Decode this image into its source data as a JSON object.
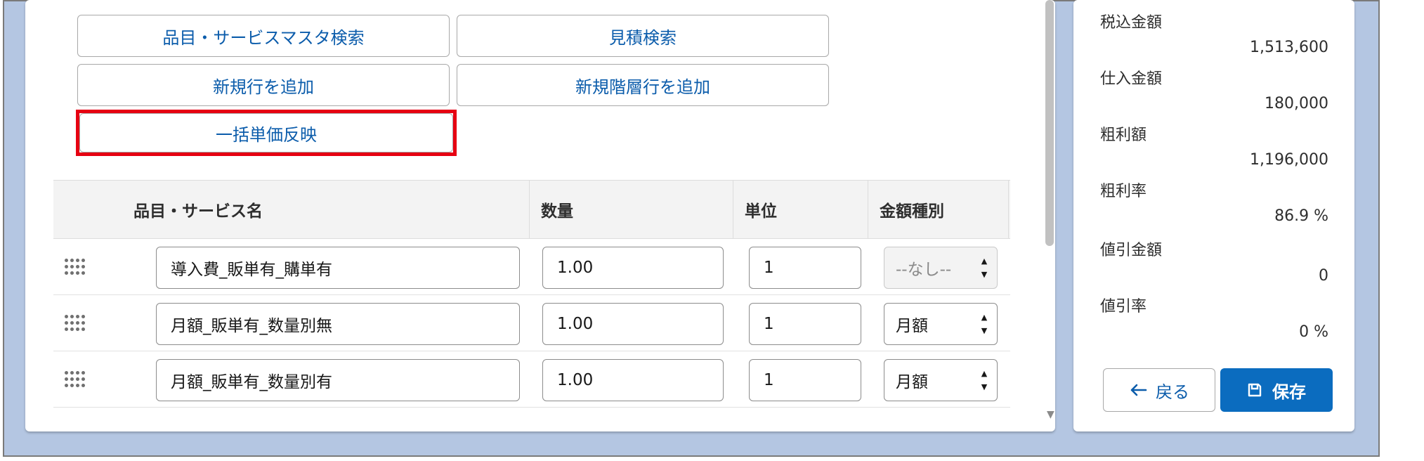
{
  "buttons": {
    "item_master_search": "品目・サービスマスタ検索",
    "quote_search": "見積検索",
    "add_new_row": "新規行を追加",
    "add_new_level_row": "新規階層行を追加",
    "bulk_apply_price": "一括単価反映"
  },
  "table": {
    "headers": [
      "品目・サービス名",
      "数量",
      "単位",
      "金額種別"
    ],
    "rows": [
      {
        "name": "導入費_販単有_購単有",
        "quantity": "1.00",
        "unit": "1",
        "amount_type": "--なし--",
        "amount_type_disabled": true
      },
      {
        "name": "月額_販単有_数量別無",
        "quantity": "1.00",
        "unit": "1",
        "amount_type": "月額",
        "amount_type_disabled": false
      },
      {
        "name": "月額_販単有_数量別有",
        "quantity": "1.00",
        "unit": "1",
        "amount_type": "月額",
        "amount_type_disabled": false
      }
    ]
  },
  "summary": {
    "tax_included_label": "税込金額",
    "tax_included_value": "1,513,600",
    "purchase_label": "仕入金額",
    "purchase_value": "180,000",
    "gross_profit_label": "粗利額",
    "gross_profit_value": "1,196,000",
    "gross_margin_label": "粗利率",
    "gross_margin_value": "86.9 %",
    "discount_amount_label": "値引金額",
    "discount_amount_value": "0",
    "discount_rate_label": "値引率",
    "discount_rate_value": "0 %"
  },
  "actions": {
    "back_label": "戻る",
    "save_label": "保存",
    "back_icon": "arrow-left-icon",
    "save_icon": "save-icon"
  },
  "colors": {
    "accent": "#0b5cab",
    "highlight": "#e60012",
    "save_bg": "#0b6cbf"
  }
}
